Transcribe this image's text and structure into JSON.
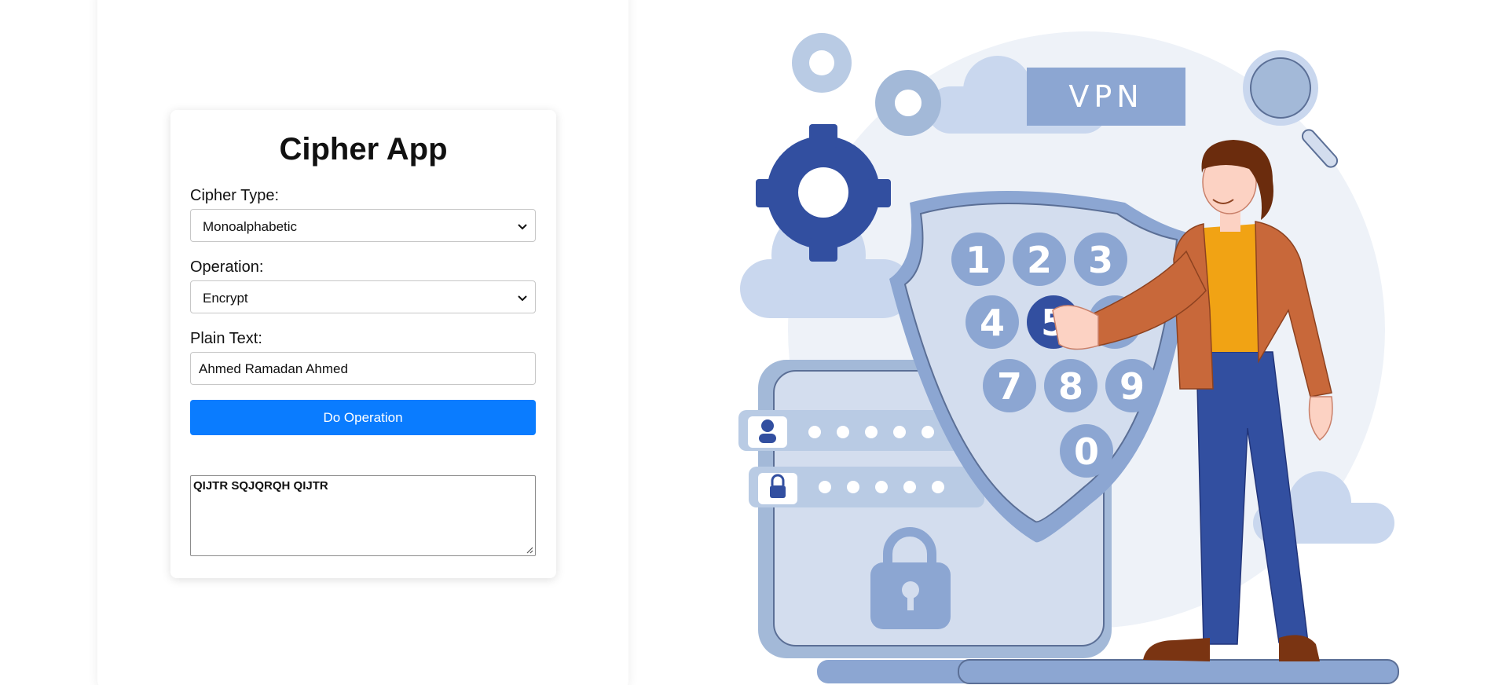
{
  "app": {
    "title": "Cipher App"
  },
  "form": {
    "cipher_type_label": "Cipher Type:",
    "cipher_type_value": "Monoalphabetic",
    "operation_label": "Operation:",
    "operation_value": "Encrypt",
    "plain_text_label": "Plain Text:",
    "plain_text_value": "Ahmed Ramadan Ahmed",
    "button_label": "Do Operation",
    "output_value": "QIJTR SQJQRQH QIJTR"
  },
  "illustration": {
    "badge_text": "VPN",
    "keypad_digits": [
      "1",
      "2",
      "3",
      "4",
      "5",
      "6",
      "7",
      "8",
      "9",
      "0"
    ]
  },
  "colors": {
    "accent": "#0a7cff",
    "illustration_dark_blue": "#324fa0",
    "illustration_mid_blue": "#8ca6d2",
    "illustration_light_blue": "#d3ddee",
    "jacket": "#c8683a",
    "shirt": "#f1a314"
  },
  "icons": {
    "select_chevron": "chevron-down-icon",
    "textarea_resize": "resize-handle-icon"
  }
}
